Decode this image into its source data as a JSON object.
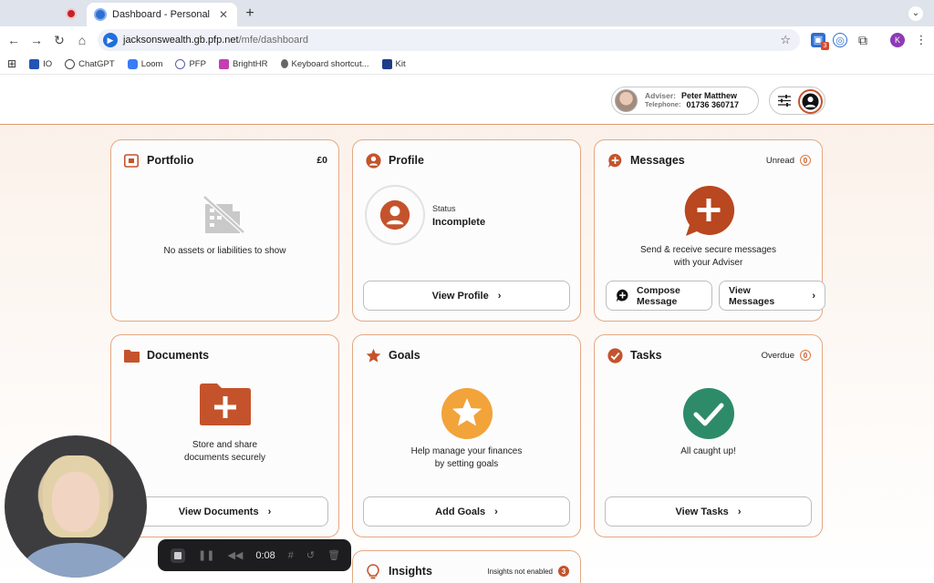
{
  "browser": {
    "tabs": [
      {
        "title": "Dashboard - Personal Financ"
      }
    ],
    "url_host": "jacksonswealth.gb.pfp.net",
    "url_path": "/mfe/dashboard",
    "extension_badge": "3",
    "profile_initial": "K",
    "bookmarks": [
      {
        "label": "IO"
      },
      {
        "label": "ChatGPT"
      },
      {
        "label": "Loom"
      },
      {
        "label": "PFP"
      },
      {
        "label": "BrightHR"
      },
      {
        "label": "Keyboard shortcut..."
      },
      {
        "label": "Kit"
      }
    ]
  },
  "header": {
    "adviser_label": "Adviser:",
    "adviser_name": "Peter Matthew",
    "telephone_label": "Telephone:",
    "telephone": "01736 360717"
  },
  "cards": {
    "portfolio": {
      "title": "Portfolio",
      "value": "£0",
      "empty_text": "No assets or liabilities to show"
    },
    "profile": {
      "title": "Profile",
      "status_label": "Status",
      "status_value": "Incomplete",
      "button": "View Profile"
    },
    "messages": {
      "title": "Messages",
      "meta_label": "Unread",
      "meta_count": "0",
      "text_line1": "Send & receive secure messages",
      "text_line2": "with your Adviser",
      "compose_line1": "Compose",
      "compose_line2": "Message",
      "view_line1": "View",
      "view_line2": "Messages"
    },
    "documents": {
      "title": "Documents",
      "text_line1": "Store and share",
      "text_line2": "documents securely",
      "button": "View Documents"
    },
    "goals": {
      "title": "Goals",
      "text_line1": "Help manage your finances",
      "text_line2": "by setting goals",
      "button": "Add Goals"
    },
    "tasks": {
      "title": "Tasks",
      "meta_label": "Overdue",
      "meta_count": "0",
      "text": "All caught up!",
      "button": "View Tasks"
    },
    "insights": {
      "title": "Insights",
      "meta_label": "Insights not enabled",
      "meta_count": "3"
    }
  },
  "recorder": {
    "time": "0:08"
  },
  "colors": {
    "accent": "#c4532c",
    "card_border": "#e3a884",
    "goals": "#f2a33a",
    "tasks": "#2d8b6a"
  }
}
